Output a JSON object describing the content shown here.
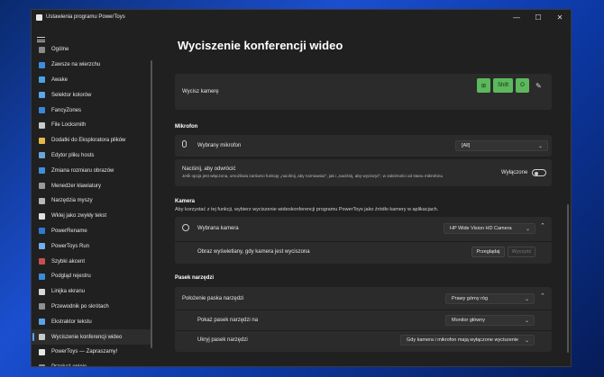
{
  "window": {
    "title": "Ustawienia programu PowerToys"
  },
  "sidebar": {
    "items": [
      {
        "label": "Ogólne",
        "color": "#8a8a8a"
      },
      {
        "label": "Zawsze na wierzchu",
        "color": "#3b8de0"
      },
      {
        "label": "Awake",
        "color": "#4aa3e6"
      },
      {
        "label": "Selektor kolorów",
        "color": "#5aa7ea"
      },
      {
        "label": "FancyZones",
        "color": "#3c86d6"
      },
      {
        "label": "File Locksmith",
        "color": "#c9c9c9"
      },
      {
        "label": "Dodatki do Eksploratora plików",
        "color": "#e6b84a"
      },
      {
        "label": "Edytor pliku hosts",
        "color": "#6aa5d9"
      },
      {
        "label": "Zmiana rozmiaru obrazów",
        "color": "#3f8fd8"
      },
      {
        "label": "Menedżer klawiatury",
        "color": "#9a9a9a"
      },
      {
        "label": "Narzędzia myszy",
        "color": "#b8b8b8"
      },
      {
        "label": "Wklej jako zwykły tekst",
        "color": "#e0e0e0"
      },
      {
        "label": "PowerRename",
        "color": "#2f7ad0"
      },
      {
        "label": "PowerToys Run",
        "color": "#6fb0e8"
      },
      {
        "label": "Szybki akcent",
        "color": "#c94f4f"
      },
      {
        "label": "Podgląd rejestru",
        "color": "#3c8bd9"
      },
      {
        "label": "Linijka ekranu",
        "color": "#d8d8d8"
      },
      {
        "label": "Przewodnik po skrótach",
        "color": "#8f8f8f"
      },
      {
        "label": "Ekstraktor tekstu",
        "color": "#5ba3e8"
      },
      {
        "label": "Wyciszenie konferencji wideo",
        "color": "#c9c9c9",
        "active": true
      },
      {
        "label": "PowerToys — Zapraszamy!",
        "color": "#e6e6e6"
      },
      {
        "label": "Przekaż opinię",
        "color": "#8f8f8f"
      }
    ]
  },
  "page": {
    "title": "Wyciszenie konferencji wideo",
    "mute_camera": {
      "label": "Wycisz kamerę",
      "keys": [
        "⊞",
        "Shift",
        "O"
      ],
      "edit_icon": "pencil-icon"
    },
    "mic_section": "Mikrofon",
    "mic": {
      "label": "Wybrany mikrofon",
      "value": "[All]"
    },
    "push_to_reverse": {
      "label": "Naciśnij, aby odwrócić",
      "desc": "Jeśli opcja jest włączona, umożliwia zarówno funkcję „naciśnij, aby rozmawiać”, jak i „naciśnij, aby wyciszyć”, w zależności od stanu mikrofonu",
      "state": "Wyłączone"
    },
    "camera_section": "Kamera",
    "camera_desc": "Aby korzystać z tej funkcji, wybierz wyciszenie wideokonferencji programu PowerToys jako źródło kamery w aplikacjach.",
    "camera": {
      "label": "Wybrana kamera",
      "value": "HP Wide Vision HD Camera"
    },
    "overlay": {
      "label": "Obraz wyświetlany, gdy kamera jest wyciszona",
      "browse": "Przeglądaj",
      "clear": "Wyczyść"
    },
    "toolbar_section": "Pasek narzędzi",
    "toolbar_pos": {
      "label": "Położenie paska narzędzi",
      "value": "Prawy górny róg"
    },
    "toolbar_show": {
      "label": "Pokaż pasek narzędzi na",
      "value": "Monitor główny"
    },
    "toolbar_hide": {
      "label": "Ukryj pasek narzędzi",
      "value": "Gdy kamera i mikrofon mają wyłączone wyciszenie"
    }
  }
}
